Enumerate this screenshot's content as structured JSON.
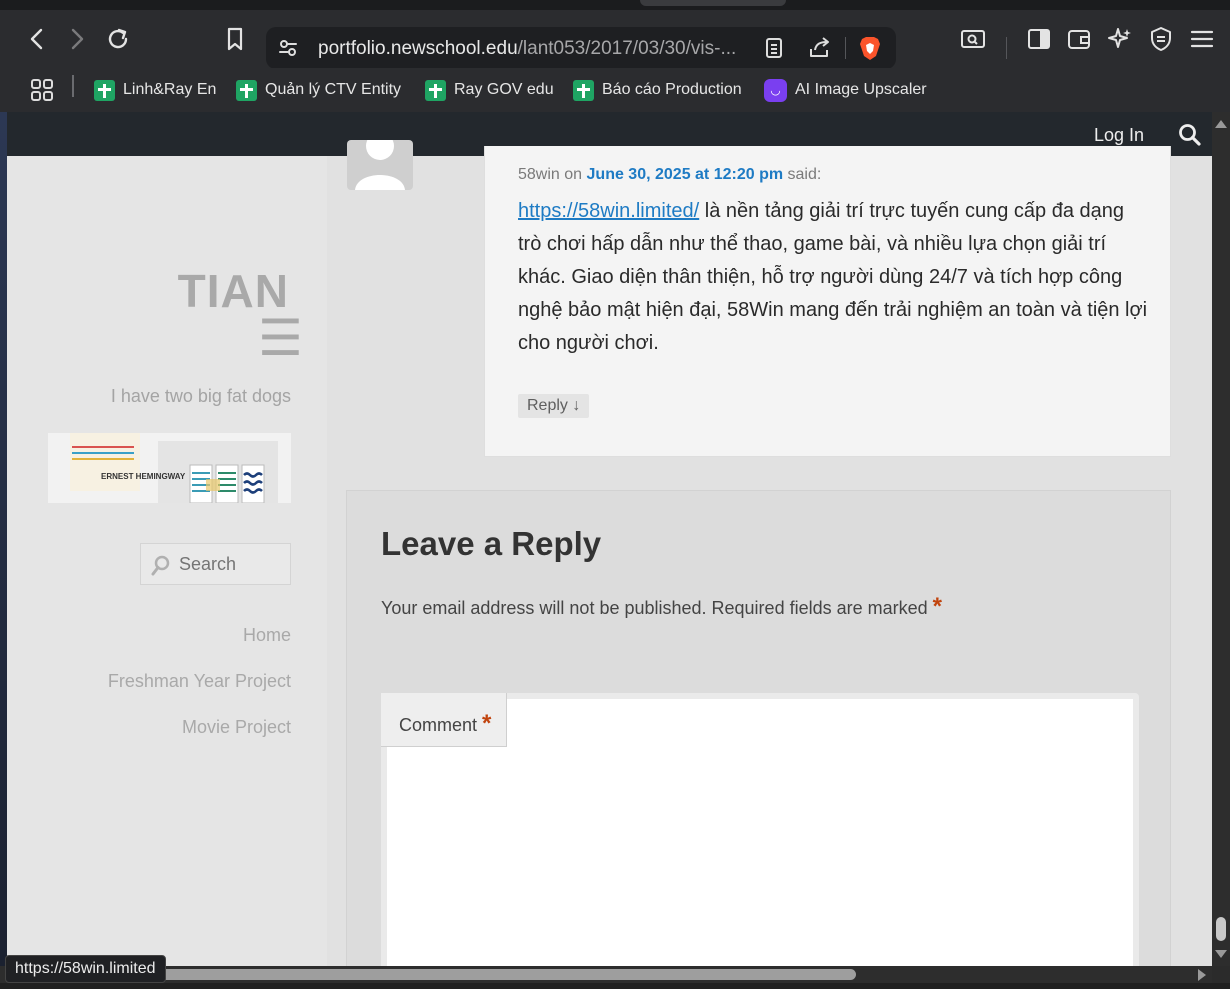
{
  "browser": {
    "url_host": "portfolio.newschool.edu",
    "url_path": "/lant053/2017/03/30/vis-...",
    "status_url": "https://58win.limited",
    "bookmarks": [
      {
        "label": "Linh&Ray En",
        "icon": "google-sheets-icon"
      },
      {
        "label": "Quản lý CTV Entity",
        "icon": "google-sheets-icon"
      },
      {
        "label": "Ray GOV edu",
        "icon": "google-sheets-icon"
      },
      {
        "label": "Báo cáo Production",
        "icon": "google-sheets-icon"
      },
      {
        "label": "AI Image Upscaler",
        "icon": "ai-upscaler-icon"
      }
    ]
  },
  "adminbar": {
    "login": "Log In"
  },
  "sidebar": {
    "site_title": "TIAN",
    "site_glyph": "☰",
    "tagline": "I have two big fat dogs",
    "banner_text": "ERNEST HEMINGWAY",
    "search_placeholder": "Search",
    "nav": [
      "Home",
      "Freshman Year Project",
      "Movie Project"
    ]
  },
  "comment": {
    "author": "58win",
    "on": "on",
    "date": "June 30, 2025 at 12:20 pm",
    "said": "said:",
    "link": "https://58win.limited/",
    "text": "là nền tảng giải trí trực tuyến cung cấp đa dạng trò chơi hấp dẫn như thể thao, game bài, và nhiều lựa chọn giải trí khác. Giao diện thân thiện, hỗ trợ người dùng 24/7 và tích hợp công nghệ bảo mật hiện đại, 58Win mang đến trải nghiệm an toàn và tiện lợi cho người chơi.",
    "reply": "Reply ↓"
  },
  "respond": {
    "title": "Leave a Reply",
    "note": "Your email address will not be published. Required fields are marked",
    "required_mark": "*",
    "comment_label": "Comment"
  },
  "colors": {
    "link": "#1e7bc4",
    "required": "#c1440e",
    "adminbar": "#23282d"
  }
}
